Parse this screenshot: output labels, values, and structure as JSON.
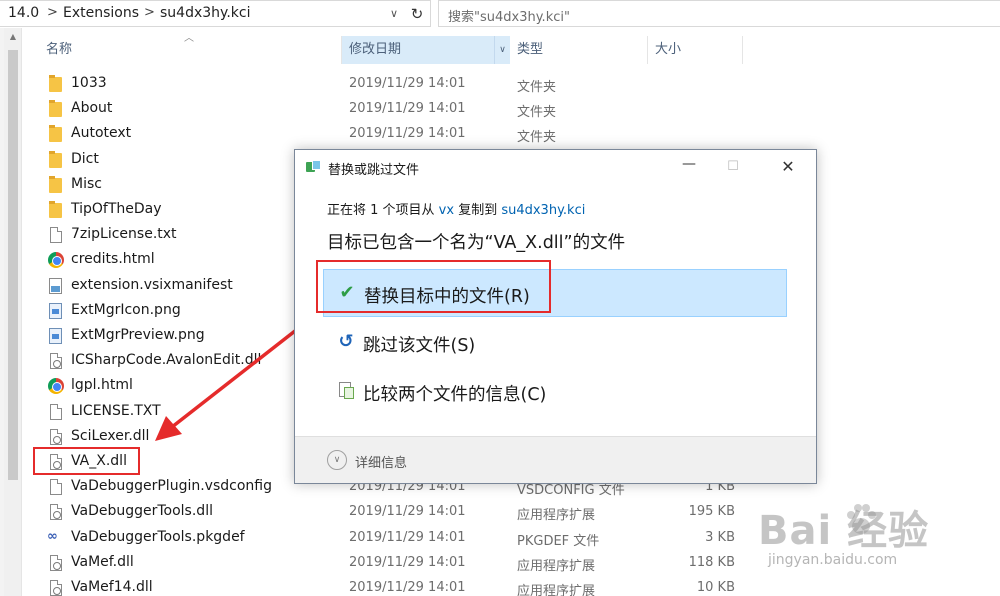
{
  "address": {
    "crumbs": [
      "14.0",
      "Extensions",
      "su4dx3hy.kci"
    ],
    "separator": ">",
    "dropdown_glyph": "∨",
    "refresh_glyph": "↻"
  },
  "search": {
    "placeholder": "搜索\"su4dx3hy.kci\""
  },
  "columns": {
    "name": "名称",
    "date": "修改日期",
    "type": "类型",
    "size": "大小"
  },
  "files": [
    {
      "name": "1033",
      "date": "2019/11/29 14:01",
      "type": "文件夹",
      "size": "",
      "icon": "folder-icon"
    },
    {
      "name": "About",
      "date": "2019/11/29 14:01",
      "type": "文件夹",
      "size": "",
      "icon": "folder-icon"
    },
    {
      "name": "Autotext",
      "date": "2019/11/29 14:01",
      "type": "文件夹",
      "size": "",
      "icon": "folder-icon"
    },
    {
      "name": "Dict",
      "date": "",
      "type": "",
      "size": "",
      "icon": "folder-icon"
    },
    {
      "name": "Misc",
      "date": "",
      "type": "",
      "size": "",
      "icon": "folder-icon"
    },
    {
      "name": "TipOfTheDay",
      "date": "",
      "type": "",
      "size": "",
      "icon": "folder-icon"
    },
    {
      "name": "7zipLicense.txt",
      "date": "",
      "type": "",
      "size": "",
      "icon": "text-file-icon"
    },
    {
      "name": "credits.html",
      "date": "",
      "type": "",
      "size": "",
      "icon": "chrome-icon"
    },
    {
      "name": "extension.vsixmanifest",
      "date": "",
      "type": "",
      "size": "",
      "icon": "vsix-file-icon"
    },
    {
      "name": "ExtMgrIcon.png",
      "date": "",
      "type": "",
      "size": "",
      "icon": "image-file-icon"
    },
    {
      "name": "ExtMgrPreview.png",
      "date": "",
      "type": "",
      "size": "",
      "icon": "image-file-icon"
    },
    {
      "name": "ICSharpCode.AvalonEdit.dll",
      "date": "",
      "type": "",
      "size": "",
      "icon": "dll-file-icon"
    },
    {
      "name": "lgpl.html",
      "date": "",
      "type": "",
      "size": "",
      "icon": "chrome-icon"
    },
    {
      "name": "LICENSE.TXT",
      "date": "",
      "type": "",
      "size": "",
      "icon": "text-file-icon"
    },
    {
      "name": "SciLexer.dll",
      "date": "",
      "type": "",
      "size": "",
      "icon": "dll-file-icon"
    },
    {
      "name": "VA_X.dll",
      "date": "",
      "type": "",
      "size": "",
      "icon": "dll-file-icon"
    },
    {
      "name": "VaDebuggerPlugin.vsdconfig",
      "date": "2019/11/29 14:01",
      "type": "VSDCONFIG 文件",
      "size": "1 KB",
      "icon": "text-file-icon"
    },
    {
      "name": "VaDebuggerTools.dll",
      "date": "2019/11/29 14:01",
      "type": "应用程序扩展",
      "size": "195 KB",
      "icon": "dll-file-icon"
    },
    {
      "name": "VaDebuggerTools.pkgdef",
      "date": "2019/11/29 14:01",
      "type": "PKGDEF 文件",
      "size": "3 KB",
      "icon": "pkgdef-file-icon"
    },
    {
      "name": "VaMef.dll",
      "date": "2019/11/29 14:01",
      "type": "应用程序扩展",
      "size": "118 KB",
      "icon": "dll-file-icon"
    },
    {
      "name": "VaMef14.dll",
      "date": "2019/11/29 14:01",
      "type": "应用程序扩展",
      "size": "10 KB",
      "icon": "dll-file-icon"
    }
  ],
  "dialog": {
    "title": "替换或跳过文件",
    "min_glyph": "—",
    "max_glyph": "☐",
    "close_glyph": "✕",
    "sub_prefix": "正在将 1 个项目从 ",
    "sub_source": "vx",
    "sub_mid": " 复制到 ",
    "sub_dest": "su4dx3hy.kci",
    "heading": "目标已包含一个名为“VA_X.dll”的文件",
    "options": [
      {
        "label": "替换目标中的文件(R)",
        "icon": "check-icon",
        "glyph": "✔"
      },
      {
        "label": "跳过该文件(S)",
        "icon": "skip-icon",
        "glyph": "↺"
      },
      {
        "label": "比较两个文件的信息(C)",
        "icon": "compare-icon",
        "glyph": ""
      }
    ],
    "details_glyph": "∨",
    "details": "详细信息"
  },
  "watermark": {
    "text": "Bai 经验",
    "sub": "jingyan.baidu.com"
  },
  "colors": {
    "accent_link": "#0063b1",
    "highlight": "#cce8ff",
    "annotation_red": "#e52b2b",
    "check_green": "#2e9d46"
  }
}
